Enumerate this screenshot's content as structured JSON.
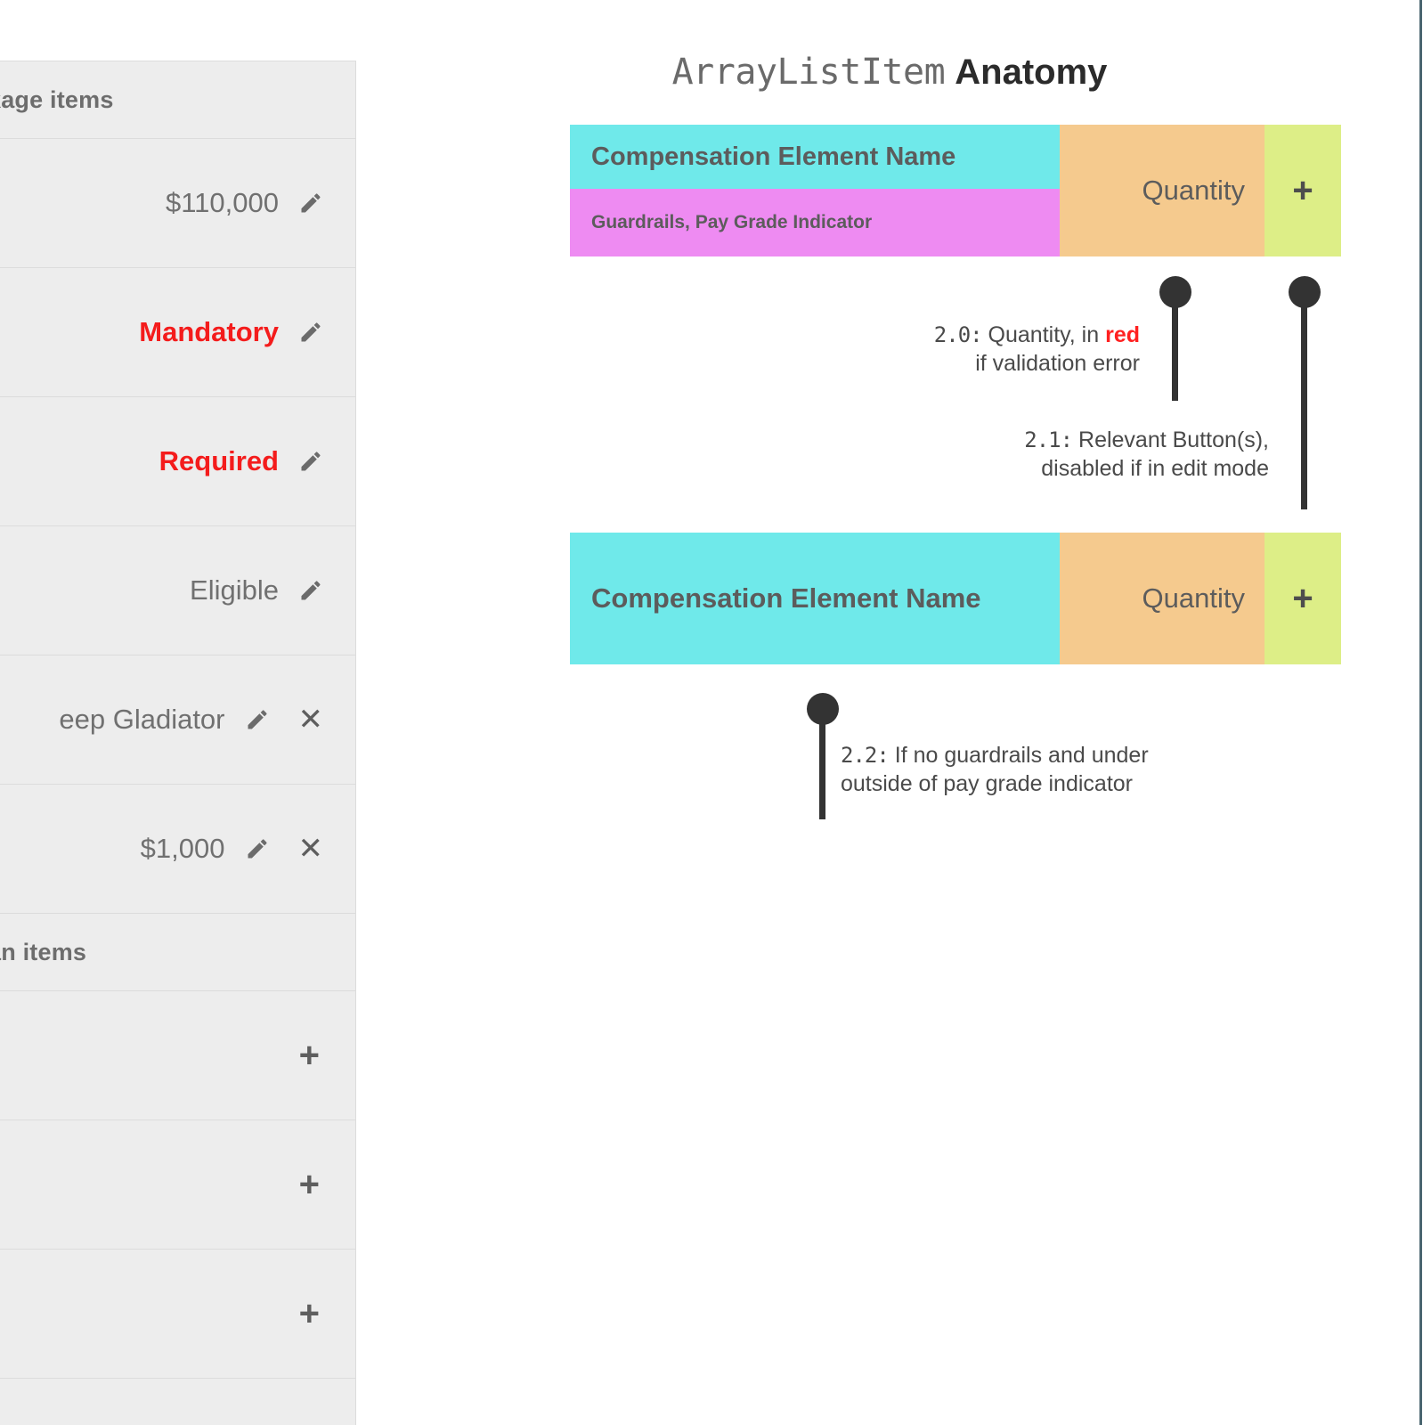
{
  "sidebar": {
    "sections": [
      {
        "kind": "header",
        "label": "kage items"
      }
    ],
    "rows": [
      {
        "value": "$110,000",
        "style": "normal",
        "icons": [
          "pencil-icon"
        ]
      },
      {
        "value": "Mandatory",
        "style": "red",
        "icons": [
          "pencil-icon"
        ]
      },
      {
        "value": "Required",
        "style": "red",
        "icons": [
          "pencil-icon"
        ]
      },
      {
        "value": "Eligible",
        "style": "normal",
        "icons": [
          "pencil-icon"
        ]
      },
      {
        "value": "eep Gladiator",
        "style": "normal",
        "icons": [
          "pencil-icon",
          "close-icon"
        ]
      },
      {
        "value": "$1,000",
        "style": "normal",
        "icons": [
          "pencil-icon",
          "close-icon"
        ]
      }
    ],
    "second_header": "an items",
    "add_rows": [
      {
        "icon": "plus-icon",
        "label": "+"
      },
      {
        "icon": "plus-icon",
        "label": "+"
      },
      {
        "icon": "plus-icon",
        "label": "+"
      }
    ]
  },
  "diagram": {
    "title_mono": "ArrayListItem",
    "title_bold": "Anatomy",
    "blocks": [
      {
        "id": "block-with-guardrails",
        "name_label": "Compensation Element Name",
        "sub_label": "Guardrails, Pay Grade Indicator",
        "quantity_label": "Quantity",
        "button_label": "+",
        "colors": {
          "name_bg": "#6FE9EA",
          "sub_bg": "#EE8BF2",
          "quantity_bg": "#F5CA8E",
          "button_bg": "#DDEE87"
        }
      },
      {
        "id": "block-no-guardrails",
        "name_label": "Compensation Element Name",
        "quantity_label": "Quantity",
        "button_label": "+",
        "colors": {
          "name_bg": "#6FE9EA",
          "quantity_bg": "#F5CA8E",
          "button_bg": "#DDEE87"
        }
      }
    ],
    "annotations": [
      {
        "id": "anno-2-0",
        "number": "2.0:",
        "text_before": " Quantity, in ",
        "highlight": "red",
        "highlight_color": "#ff2020",
        "text_after": "\nif validation error"
      },
      {
        "id": "anno-2-1",
        "number": "2.1:",
        "text": " Relevant Button(s),\ndisabled if in edit mode"
      },
      {
        "id": "anno-2-2",
        "number": "2.2:",
        "text": " If no guardrails and under\noutside of pay grade indicator"
      }
    ]
  }
}
